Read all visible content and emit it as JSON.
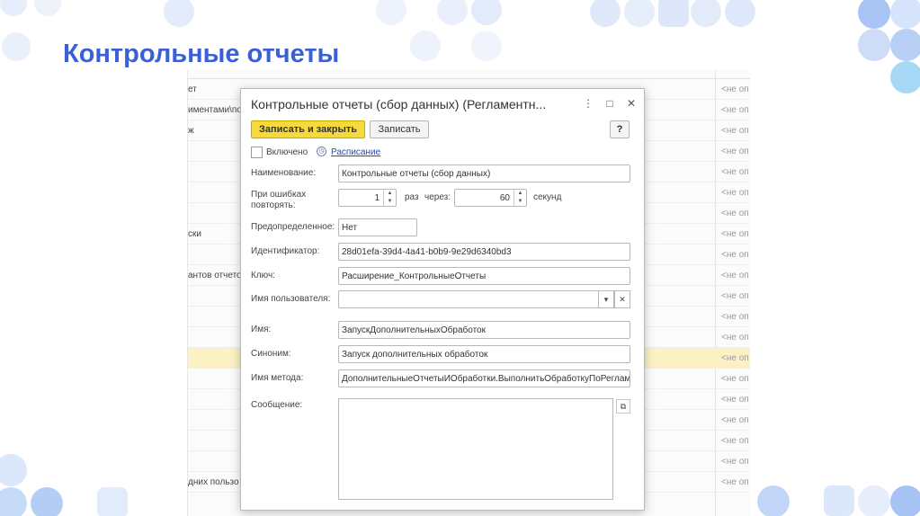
{
  "slide": {
    "title": "Контрольные отчеты"
  },
  "background_list": {
    "rows": [
      {
        "c1": "ет",
        "c2": "<не оп",
        "sel": false
      },
      {
        "c1": "иментами\\пос",
        "c2": "<не оп",
        "sel": false
      },
      {
        "c1": "ж",
        "c2": "<не оп",
        "sel": false
      },
      {
        "c1": "",
        "c2": "<не оп",
        "sel": false
      },
      {
        "c1": "",
        "c2": "<не оп",
        "sel": false
      },
      {
        "c1": "",
        "c2": "<не оп",
        "sel": false
      },
      {
        "c1": "",
        "c2": "<не оп",
        "sel": false
      },
      {
        "c1": "ски",
        "c2": "<не оп",
        "sel": false
      },
      {
        "c1": "",
        "c2": "<не оп",
        "sel": false
      },
      {
        "c1": "антов отчето",
        "c2": "<не оп",
        "sel": false
      },
      {
        "c1": "",
        "c2": "<не оп",
        "sel": false
      },
      {
        "c1": "",
        "c2": "<не оп",
        "sel": false
      },
      {
        "c1": "",
        "c2": "<не оп",
        "sel": false
      },
      {
        "c1": "",
        "c2": "<не оп",
        "sel": true
      },
      {
        "c1": "",
        "c2": "<не оп",
        "sel": false
      },
      {
        "c1": "",
        "c2": "<не оп",
        "sel": false
      },
      {
        "c1": "",
        "c2": "<не оп",
        "sel": false
      },
      {
        "c1": "",
        "c2": "<не оп",
        "sel": false
      },
      {
        "c1": "",
        "c2": "<не оп",
        "sel": false
      },
      {
        "c1": "дних пользо",
        "c2": "<не оп",
        "sel": false
      }
    ]
  },
  "dialog": {
    "title": "Контрольные отчеты (сбор данных) (Регламентн...",
    "toolbar": {
      "save_close_label": "Записать и закрыть",
      "save_label": "Записать",
      "help_label": "?"
    },
    "enabled": {
      "label": "Включено",
      "checked": false
    },
    "schedule_link": "Расписание",
    "fields": {
      "name": {
        "label": "Наименование:",
        "value": "Контрольные отчеты (сбор данных)"
      },
      "retry": {
        "label": "При ошибках повторять:",
        "count": "1",
        "times_label": "раз",
        "via_label": "через:",
        "interval": "60",
        "seconds_label": "секунд"
      },
      "predefined": {
        "label": "Предопределенное:",
        "value": "Нет"
      },
      "identifier": {
        "label": "Идентификатор:",
        "value": "28d01efa-39d4-4a41-b0b9-9e29d6340bd3"
      },
      "key": {
        "label": "Ключ:",
        "value": "Расширение_КонтрольныеОтчеты"
      },
      "user_name": {
        "label": "Имя пользователя:",
        "value": ""
      },
      "job_name": {
        "label": "Имя:",
        "value": "ЗапускДополнительныхОбработок"
      },
      "synonym": {
        "label": "Синоним:",
        "value": "Запуск дополнительных обработок"
      },
      "method_name": {
        "label": "Имя метода:",
        "value": "ДополнительныеОтчетыИОбработки.ВыполнитьОбработкуПоРеглам"
      },
      "message": {
        "label": "Сообщение:",
        "value": ""
      }
    }
  }
}
